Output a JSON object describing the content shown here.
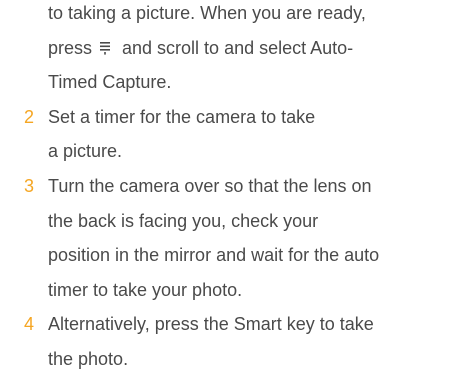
{
  "steps": {
    "intro": {
      "line1": "to taking a picture. When you are ready,",
      "line2_before": "press",
      "line2_icon": "menu-icon",
      "line2_after": "and scroll to and select Auto-",
      "line3": "Timed Capture."
    },
    "step2": {
      "number": "2",
      "line1": "Set a timer for the camera to take",
      "line2": "a picture."
    },
    "step3": {
      "number": "3",
      "line1": "Turn the camera over so that the lens on",
      "line2": "the back is facing you, check your",
      "line3": "position in the mirror and wait for the auto",
      "line4": "timer to take your photo."
    },
    "step4": {
      "number": "4",
      "line1": "Alternatively, press the Smart key to take",
      "line2": "the photo."
    }
  },
  "colors": {
    "text": "#4a4a4a",
    "step_number": "#f5a623"
  }
}
